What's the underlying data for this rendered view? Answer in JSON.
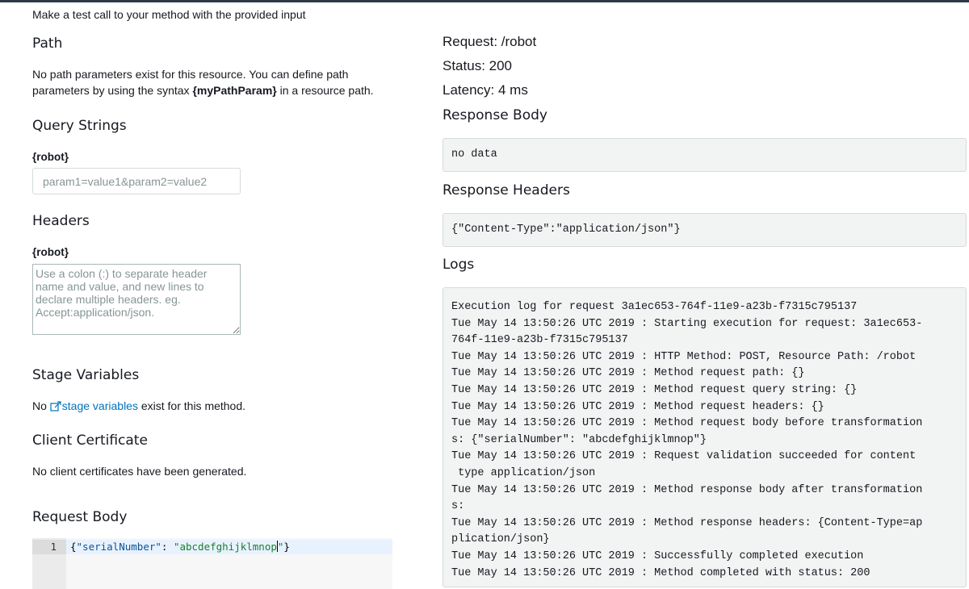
{
  "intro": "Make a test call to your method with the provided input",
  "path": {
    "title": "Path",
    "line1": "No path parameters exist for this resource. You can define path",
    "line2_pre": "parameters by using the syntax ",
    "line2_bold": "{myPathParam}",
    "line2_post": " in a resource path."
  },
  "query": {
    "title": "Query Strings",
    "label": "{robot}",
    "placeholder": "param1=value1&param2=value2"
  },
  "headers": {
    "title": "Headers",
    "label": "{robot}",
    "placeholder": "Use a colon (:) to separate header name and value, and new lines to declare multiple headers. eg. Accept:application/json."
  },
  "stage": {
    "title": "Stage Variables",
    "pre": "No ",
    "link": "stage variables",
    "post": " exist for this method."
  },
  "cert": {
    "title": "Client Certificate",
    "text": "No client certificates have been generated."
  },
  "request_body": {
    "title": "Request Body",
    "line_number": "1",
    "open": "{",
    "key": "\"serialNumber\"",
    "colon": ": ",
    "value_a": "\"abcdefghijklmnop",
    "value_b": "\"",
    "close": "}"
  },
  "response": {
    "request": "Request: /robot",
    "status": "Status: 200",
    "latency": "Latency: 4 ms",
    "body_title": "Response Body",
    "body": "no data",
    "headers_title": "Response Headers",
    "headers": "{\"Content-Type\":\"application/json\"}",
    "logs_title": "Logs",
    "logs": [
      "Execution log for request 3a1ec653-764f-11e9-a23b-f7315c795137",
      "Tue May 14 13:50:26 UTC 2019 : Starting execution for request: 3a1ec653-",
      "764f-11e9-a23b-f7315c795137",
      "Tue May 14 13:50:26 UTC 2019 : HTTP Method: POST, Resource Path: /robot",
      "Tue May 14 13:50:26 UTC 2019 : Method request path: {}",
      "Tue May 14 13:50:26 UTC 2019 : Method request query string: {}",
      "Tue May 14 13:50:26 UTC 2019 : Method request headers: {}",
      "Tue May 14 13:50:26 UTC 2019 : Method request body before transformation",
      "s: {\"serialNumber\": \"abcdefghijklmnop\"}",
      "Tue May 14 13:50:26 UTC 2019 : Request validation succeeded for content",
      " type application/json",
      "Tue May 14 13:50:26 UTC 2019 : Method response body after transformation",
      "s:",
      "Tue May 14 13:50:26 UTC 2019 : Method response headers: {Content-Type=ap",
      "plication/json}",
      "Tue May 14 13:50:26 UTC 2019 : Successfully completed execution",
      "Tue May 14 13:50:26 UTC 2019 : Method completed with status: 200"
    ]
  },
  "colors": {
    "text": "#16191f",
    "link": "#0073bb",
    "code_bg": "#f2f3f3",
    "border": "#d5dbdb"
  },
  "icons": {
    "external_link": "external-link-icon"
  }
}
